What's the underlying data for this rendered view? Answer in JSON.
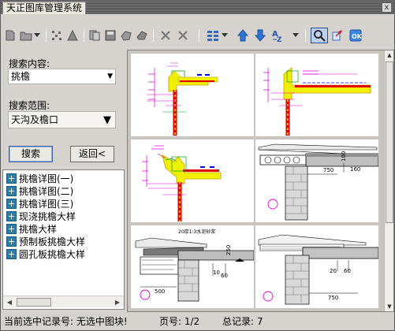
{
  "window": {
    "title": "天正图库管理系统",
    "close_glyph": "x"
  },
  "toolbar": {
    "buttons": [
      {
        "name": "new-page-icon"
      },
      {
        "name": "folder-icon"
      },
      {
        "name": "dropdown-arrow-icon"
      },
      {
        "name": "scatter-icon"
      },
      {
        "name": "triangle-icon"
      },
      {
        "name": "copy-block-icon"
      },
      {
        "name": "save-block-icon"
      },
      {
        "name": "redefine-block-icon"
      },
      {
        "name": "delete-x-icon"
      },
      {
        "name": "delete-x2-icon"
      },
      {
        "name": "view-grid-icon"
      },
      {
        "name": "move-up-icon"
      },
      {
        "name": "move-down-icon"
      },
      {
        "name": "sort-az-icon"
      },
      {
        "name": "search-icon"
      },
      {
        "name": "insert-icon"
      },
      {
        "name": "ok-icon"
      }
    ]
  },
  "search": {
    "content_label": "搜索内容:",
    "content_value": "挑檐",
    "scope_label": "搜索范围:",
    "scope_value": "天沟及檐口",
    "search_button": "搜索",
    "back_button": "返回<"
  },
  "results": {
    "items": [
      {
        "label": "挑檐详图(一)"
      },
      {
        "label": "挑檐详图(二)"
      },
      {
        "label": "挑檐详图(三)"
      },
      {
        "label": "现浇挑檐大样"
      },
      {
        "label": "挑檐大样"
      },
      {
        "label": "预制板挑檐大样"
      },
      {
        "label": "圆孔板挑檐大样"
      }
    ]
  },
  "preview": {
    "drawing_labels": {
      "d750": "750",
      "d500": "500",
      "d60": "60",
      "d10": "10",
      "d20": "20",
      "d100": "100",
      "d160": "160",
      "d250": "250",
      "note": "20厚1:3水泥砂浆"
    }
  },
  "statusbar": {
    "current_label": "当前选中记录号: 无选中图块!",
    "page_label": "页号: 1/2",
    "total_label": "总记录: 7"
  },
  "colors": {
    "accent_magenta": "#e000e0",
    "cad_yellow": "#f0f000",
    "cad_red": "#e00000",
    "cad_blue": "#0000ff",
    "cad_green": "#00a000"
  }
}
